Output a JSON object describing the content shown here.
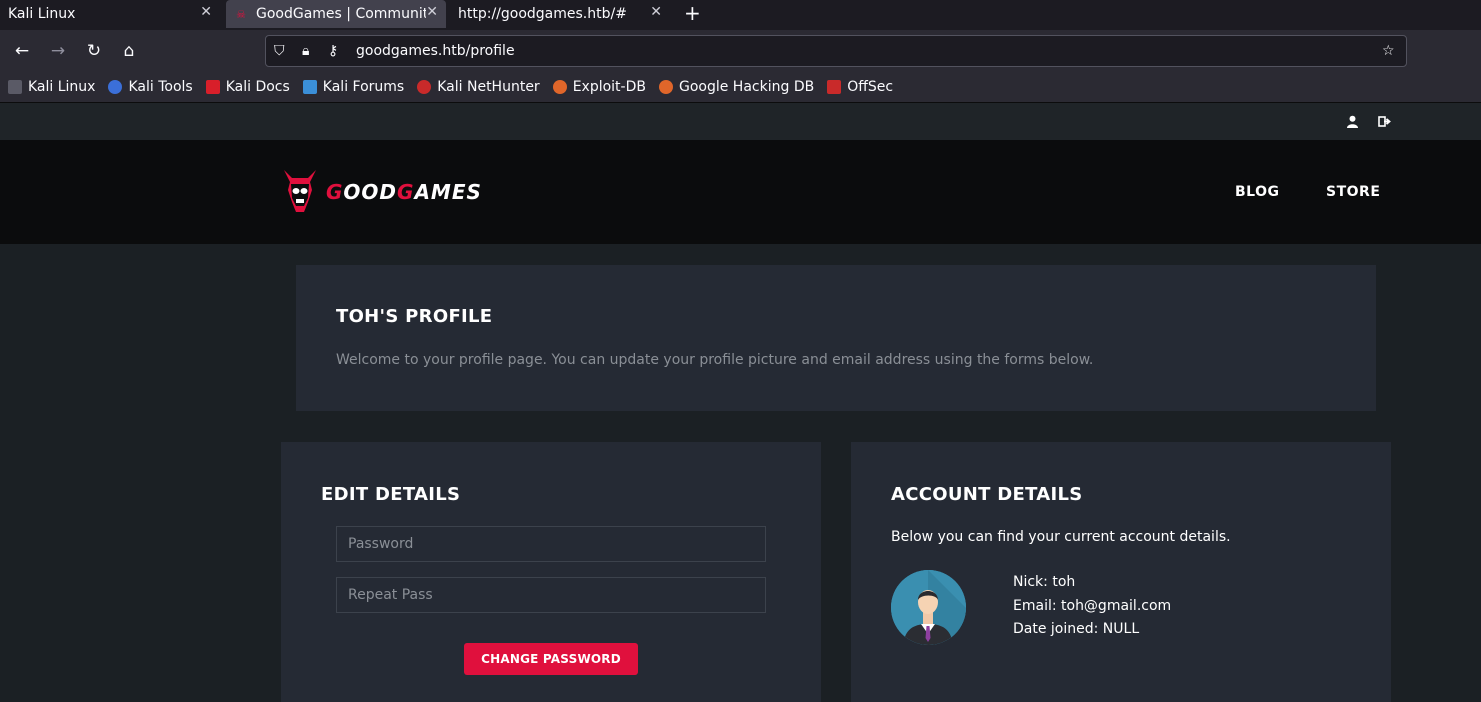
{
  "browser": {
    "tabs": [
      {
        "title": "Kali Linux"
      },
      {
        "title": "GoodGames | Community and Store"
      },
      {
        "title": "http://goodgames.htb/#"
      }
    ],
    "url": "goodgames.htb/profile",
    "bookmarks": [
      {
        "label": "Kali Linux",
        "color": "#1c1b22"
      },
      {
        "label": "Kali Tools",
        "color": "#3b6fd8"
      },
      {
        "label": "Kali Docs",
        "color": "#d81f2a"
      },
      {
        "label": "Kali Forums",
        "color": "#3b8fd8"
      },
      {
        "label": "Kali NetHunter",
        "color": "#c92a2a"
      },
      {
        "label": "Exploit-DB",
        "color": "#e0662a"
      },
      {
        "label": "Google Hacking DB",
        "color": "#e0662a"
      },
      {
        "label": "OffSec",
        "color": "#c92a2a"
      }
    ]
  },
  "site": {
    "logo_text_a": "G",
    "logo_text_b": "OOD",
    "logo_text_c": "G",
    "logo_text_d": "AMES",
    "menu": [
      "BLOG",
      "STORE"
    ],
    "accent": "#e0103d"
  },
  "profile": {
    "title": "TOH'S PROFILE",
    "intro": "Welcome to your profile page. You can update your profile picture and email address using the forms below."
  },
  "edit": {
    "title": "EDIT DETAILS",
    "password_placeholder": "Password",
    "repeat_placeholder": "Repeat Pass",
    "button": "CHANGE PASSWORD"
  },
  "account": {
    "title": "ACCOUNT DETAILS",
    "subtitle": "Below you can find your current account details.",
    "nick": "Nick: toh",
    "email": "Email: toh@gmail.com",
    "joined": "Date joined: NULL"
  }
}
